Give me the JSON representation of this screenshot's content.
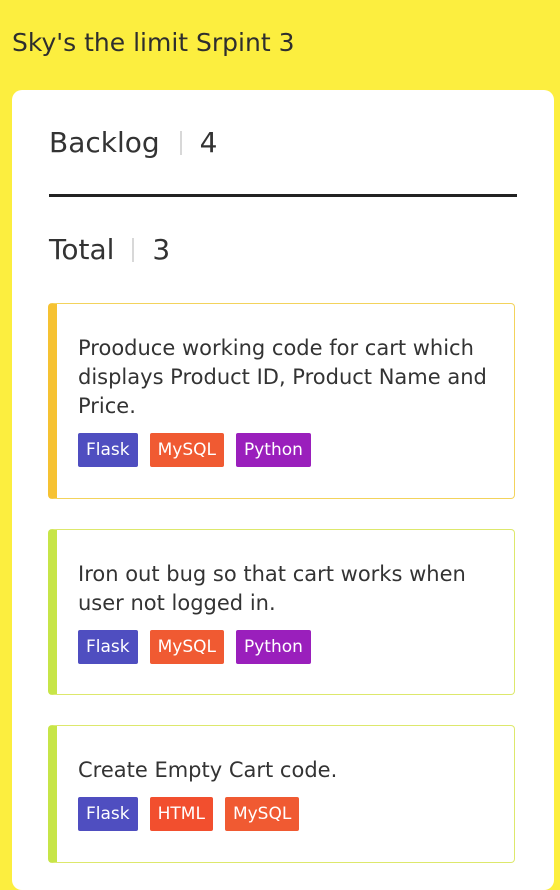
{
  "sprint": {
    "title": "Sky's the limit Srpint 3"
  },
  "column": {
    "name": "Backlog",
    "count": "4",
    "total_label": "Total",
    "total_count": "3"
  },
  "cards": [
    {
      "text": "Prooduce working code for cart which displays Product ID, Product Name and Price.",
      "accent": "#f6c232",
      "tags": [
        "Flask",
        "MySQL",
        "Python"
      ]
    },
    {
      "text": "Iron out bug so that cart works when user not logged in.",
      "accent": "#c7e548",
      "tags": [
        "Flask",
        "MySQL",
        "Python"
      ]
    },
    {
      "text": "Create Empty Cart code.",
      "accent": "#c7e548",
      "tags": [
        "Flask",
        "HTML",
        "MySQL"
      ]
    }
  ],
  "colors": {
    "background": "#fcee3f",
    "flask": "#4f4ec0",
    "mysql": "#f05a32",
    "python": "#9a1fbc",
    "html": "#f24f2e"
  }
}
